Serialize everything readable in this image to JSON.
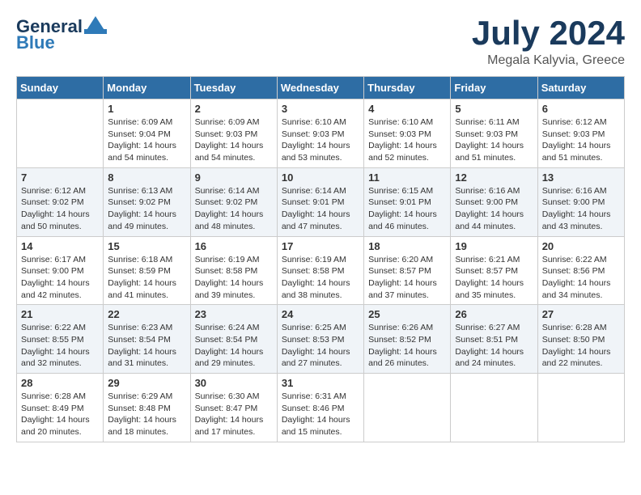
{
  "header": {
    "logo_general": "General",
    "logo_blue": "Blue",
    "month_title": "July 2024",
    "location": "Megala Kalyvia, Greece"
  },
  "calendar": {
    "days_of_week": [
      "Sunday",
      "Monday",
      "Tuesday",
      "Wednesday",
      "Thursday",
      "Friday",
      "Saturday"
    ],
    "weeks": [
      [
        {
          "day": "",
          "info": ""
        },
        {
          "day": "1",
          "info": "Sunrise: 6:09 AM\nSunset: 9:04 PM\nDaylight: 14 hours\nand 54 minutes."
        },
        {
          "day": "2",
          "info": "Sunrise: 6:09 AM\nSunset: 9:03 PM\nDaylight: 14 hours\nand 54 minutes."
        },
        {
          "day": "3",
          "info": "Sunrise: 6:10 AM\nSunset: 9:03 PM\nDaylight: 14 hours\nand 53 minutes."
        },
        {
          "day": "4",
          "info": "Sunrise: 6:10 AM\nSunset: 9:03 PM\nDaylight: 14 hours\nand 52 minutes."
        },
        {
          "day": "5",
          "info": "Sunrise: 6:11 AM\nSunset: 9:03 PM\nDaylight: 14 hours\nand 51 minutes."
        },
        {
          "day": "6",
          "info": "Sunrise: 6:12 AM\nSunset: 9:03 PM\nDaylight: 14 hours\nand 51 minutes."
        }
      ],
      [
        {
          "day": "7",
          "info": "Sunrise: 6:12 AM\nSunset: 9:02 PM\nDaylight: 14 hours\nand 50 minutes."
        },
        {
          "day": "8",
          "info": "Sunrise: 6:13 AM\nSunset: 9:02 PM\nDaylight: 14 hours\nand 49 minutes."
        },
        {
          "day": "9",
          "info": "Sunrise: 6:14 AM\nSunset: 9:02 PM\nDaylight: 14 hours\nand 48 minutes."
        },
        {
          "day": "10",
          "info": "Sunrise: 6:14 AM\nSunset: 9:01 PM\nDaylight: 14 hours\nand 47 minutes."
        },
        {
          "day": "11",
          "info": "Sunrise: 6:15 AM\nSunset: 9:01 PM\nDaylight: 14 hours\nand 46 minutes."
        },
        {
          "day": "12",
          "info": "Sunrise: 6:16 AM\nSunset: 9:00 PM\nDaylight: 14 hours\nand 44 minutes."
        },
        {
          "day": "13",
          "info": "Sunrise: 6:16 AM\nSunset: 9:00 PM\nDaylight: 14 hours\nand 43 minutes."
        }
      ],
      [
        {
          "day": "14",
          "info": "Sunrise: 6:17 AM\nSunset: 9:00 PM\nDaylight: 14 hours\nand 42 minutes."
        },
        {
          "day": "15",
          "info": "Sunrise: 6:18 AM\nSunset: 8:59 PM\nDaylight: 14 hours\nand 41 minutes."
        },
        {
          "day": "16",
          "info": "Sunrise: 6:19 AM\nSunset: 8:58 PM\nDaylight: 14 hours\nand 39 minutes."
        },
        {
          "day": "17",
          "info": "Sunrise: 6:19 AM\nSunset: 8:58 PM\nDaylight: 14 hours\nand 38 minutes."
        },
        {
          "day": "18",
          "info": "Sunrise: 6:20 AM\nSunset: 8:57 PM\nDaylight: 14 hours\nand 37 minutes."
        },
        {
          "day": "19",
          "info": "Sunrise: 6:21 AM\nSunset: 8:57 PM\nDaylight: 14 hours\nand 35 minutes."
        },
        {
          "day": "20",
          "info": "Sunrise: 6:22 AM\nSunset: 8:56 PM\nDaylight: 14 hours\nand 34 minutes."
        }
      ],
      [
        {
          "day": "21",
          "info": "Sunrise: 6:22 AM\nSunset: 8:55 PM\nDaylight: 14 hours\nand 32 minutes."
        },
        {
          "day": "22",
          "info": "Sunrise: 6:23 AM\nSunset: 8:54 PM\nDaylight: 14 hours\nand 31 minutes."
        },
        {
          "day": "23",
          "info": "Sunrise: 6:24 AM\nSunset: 8:54 PM\nDaylight: 14 hours\nand 29 minutes."
        },
        {
          "day": "24",
          "info": "Sunrise: 6:25 AM\nSunset: 8:53 PM\nDaylight: 14 hours\nand 27 minutes."
        },
        {
          "day": "25",
          "info": "Sunrise: 6:26 AM\nSunset: 8:52 PM\nDaylight: 14 hours\nand 26 minutes."
        },
        {
          "day": "26",
          "info": "Sunrise: 6:27 AM\nSunset: 8:51 PM\nDaylight: 14 hours\nand 24 minutes."
        },
        {
          "day": "27",
          "info": "Sunrise: 6:28 AM\nSunset: 8:50 PM\nDaylight: 14 hours\nand 22 minutes."
        }
      ],
      [
        {
          "day": "28",
          "info": "Sunrise: 6:28 AM\nSunset: 8:49 PM\nDaylight: 14 hours\nand 20 minutes."
        },
        {
          "day": "29",
          "info": "Sunrise: 6:29 AM\nSunset: 8:48 PM\nDaylight: 14 hours\nand 18 minutes."
        },
        {
          "day": "30",
          "info": "Sunrise: 6:30 AM\nSunset: 8:47 PM\nDaylight: 14 hours\nand 17 minutes."
        },
        {
          "day": "31",
          "info": "Sunrise: 6:31 AM\nSunset: 8:46 PM\nDaylight: 14 hours\nand 15 minutes."
        },
        {
          "day": "",
          "info": ""
        },
        {
          "day": "",
          "info": ""
        },
        {
          "day": "",
          "info": ""
        }
      ]
    ]
  }
}
